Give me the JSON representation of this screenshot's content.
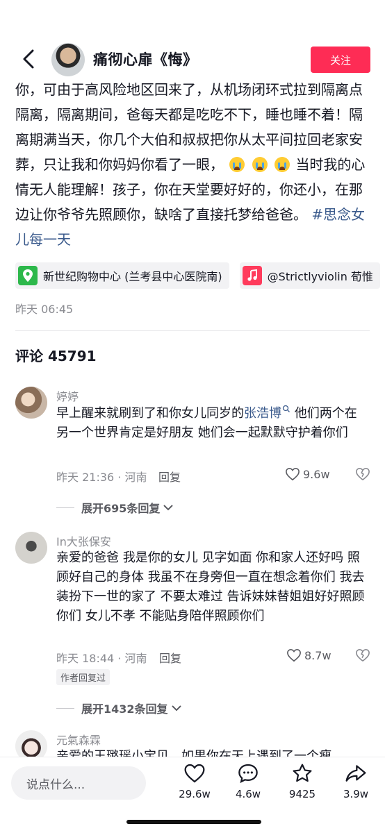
{
  "header": {
    "back_icon": "chevron-left-icon",
    "author_name": "痛彻心扉《悔》",
    "follow_label": "关注"
  },
  "post": {
    "caption_text": "你，可由于高风险地区回来了，从机场闭环式拉到隔离点隔离，隔离期间，爸每天都是吃吃不下，睡也睡不着！隔离期满当天，你几个大伯和叔叔把你从太平间拉回老家安葬，只让我和你妈妈你看了一眼，",
    "caption_text_2": "当时我的心情无人能理解！孩子，你在天堂要好好的，你还小，在那边让你爷爷先照顾你，缺啥了直接托梦给爸爸。",
    "hashtag": "#思念女儿每一天",
    "location_tag": "新世纪购物中心 (兰考县中心医院南)",
    "music_tag": "@Strictlyviolin 荀惟",
    "time": "昨天 06:45"
  },
  "comments_header": {
    "label": "评论",
    "count": "45791"
  },
  "comments": [
    {
      "name": "婷婷",
      "text_before": "早上醒来就刷到了和你女儿同岁的",
      "link": "张浩博",
      "text_after": " 他们两个在另一个世界肯定是好朋友 她们会一起默默守护着你们",
      "meta": "昨天 21:36 · 河南",
      "reply": "回复",
      "likes": "9.6w",
      "expand": "展开695条回复"
    },
    {
      "name": "In大张保安",
      "text": "亲爱的爸爸 我是你的女儿 见字如面 你和家人还好吗 照顾好自己的身体 我虽不在身旁但一直在想念着你们 我去装扮下一世的家了 不要太难过 告诉妹妹替姐姐好好照顾你们 女儿不孝 不能贴身陪伴照顾你们",
      "meta": "昨天 18:44 · 河南",
      "reply": "回复",
      "likes": "8.7w",
      "badge": "作者回复过",
      "expand": "展开1432条回复"
    },
    {
      "name": "元氣森霖",
      "text": "亲爱的王璐瑶小宝贝，如果你在天上遇到了一个瘦"
    }
  ],
  "bottom_bar": {
    "input_placeholder": "说点什么...",
    "likes": "29.6w",
    "comments": "4.6w",
    "favorites": "9425",
    "shares": "3.9w"
  },
  "colors": {
    "accent": "#fe2c55",
    "link": "#3a5a8c",
    "location_green": "#2db84b",
    "music_red": "#ff3b5c"
  }
}
